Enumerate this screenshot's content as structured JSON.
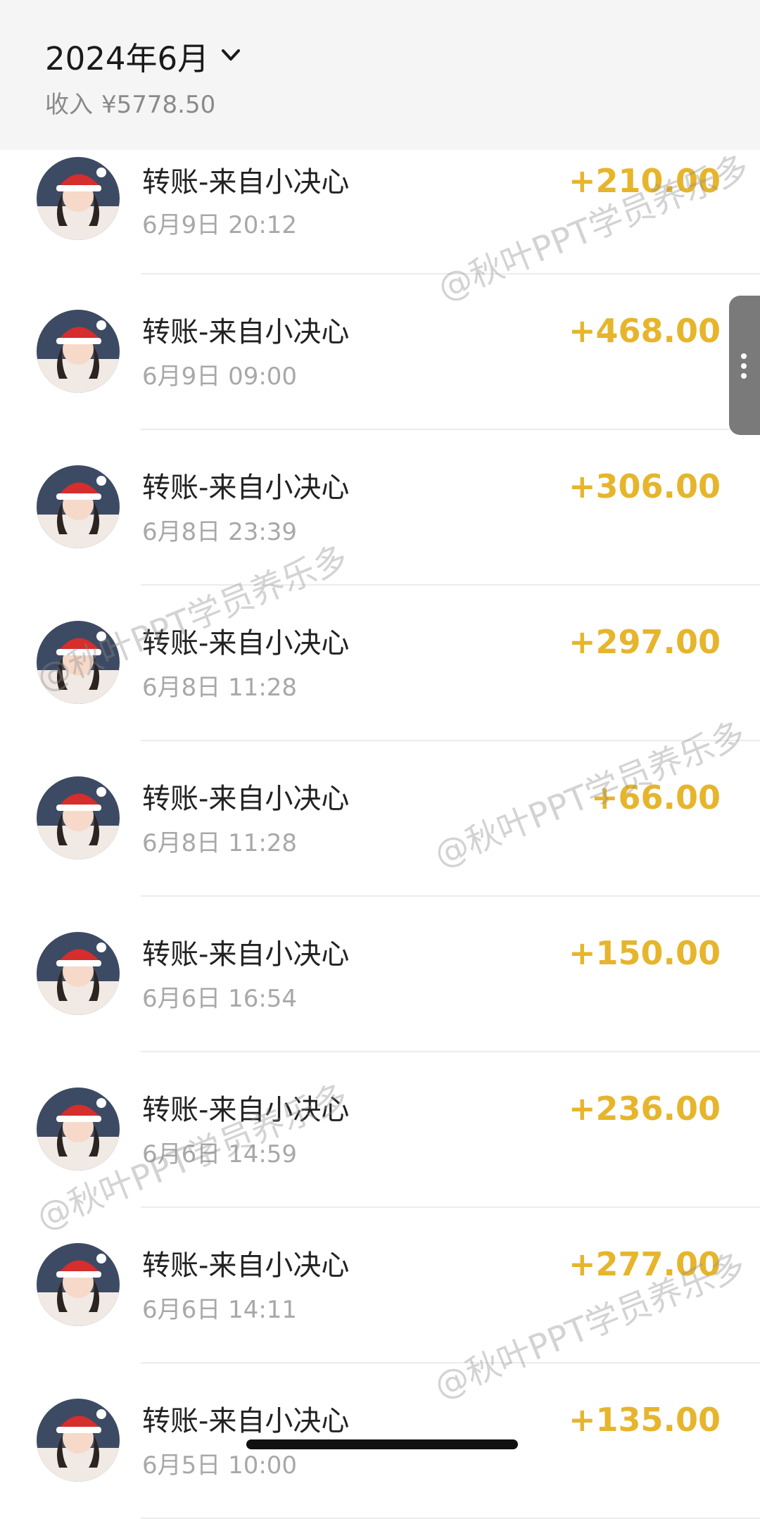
{
  "header": {
    "month": "2024年6月",
    "income_label": "收入",
    "income_amount": "¥5778.50"
  },
  "transactions": [
    {
      "title": "转账-来自小决心",
      "time": "6月9日 20:12",
      "amount": "+210.00"
    },
    {
      "title": "转账-来自小决心",
      "time": "6月9日 09:00",
      "amount": "+468.00"
    },
    {
      "title": "转账-来自小决心",
      "time": "6月8日 23:39",
      "amount": "+306.00"
    },
    {
      "title": "转账-来自小决心",
      "time": "6月8日 11:28",
      "amount": "+297.00"
    },
    {
      "title": "转账-来自小决心",
      "time": "6月8日 11:28",
      "amount": "+66.00"
    },
    {
      "title": "转账-来自小决心",
      "time": "6月6日 16:54",
      "amount": "+150.00"
    },
    {
      "title": "转账-来自小决心",
      "time": "6月6日 14:59",
      "amount": "+236.00"
    },
    {
      "title": "转账-来自小决心",
      "time": "6月6日 14:11",
      "amount": "+277.00"
    },
    {
      "title": "转账-来自小决心",
      "time": "6月5日 10:00",
      "amount": "+135.00"
    }
  ],
  "watermark": "@秋叶PPT学员养乐多",
  "colors": {
    "amount": "#e6b52c",
    "header_bg": "#f5f5f5",
    "time_text": "#a8a8a8"
  },
  "icons": [
    "chevron-down-icon",
    "avatar",
    "scroll-handle-dots-icon"
  ]
}
